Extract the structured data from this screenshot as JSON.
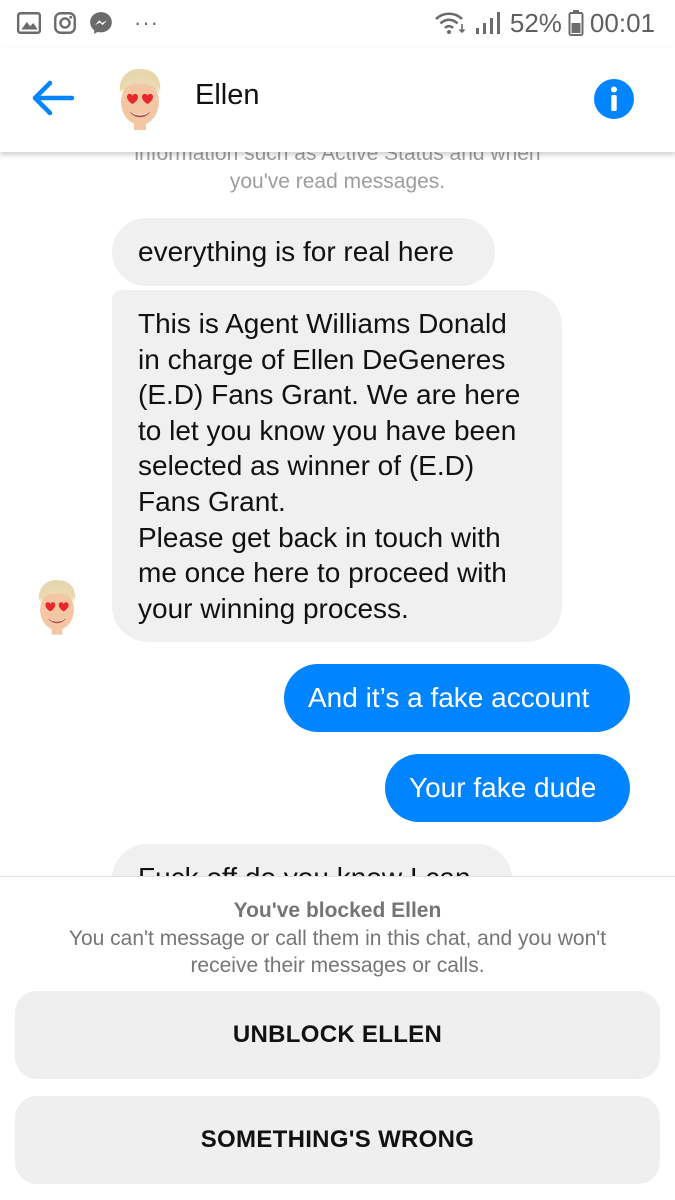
{
  "status_bar": {
    "icons_left": [
      "gallery-icon",
      "instagram-icon",
      "messenger-icon"
    ],
    "more": "···",
    "battery": "52%",
    "time": "00:01"
  },
  "header": {
    "contact_name": "Ellen",
    "back_icon": "back-arrow-icon",
    "info_icon": "info-icon"
  },
  "chat": {
    "privacy_note_line1": "information such as Active Status and when",
    "privacy_note_line2": "you've read messages.",
    "messages": [
      {
        "sender": "contact",
        "lines": [
          "everything is for real here"
        ]
      },
      {
        "sender": "contact",
        "lines": [
          "This is Agent Williams Donald",
          "in charge of Ellen DeGeneres",
          "(E.D) Fans Grant. We are here",
          "to let you know you have been",
          "selected as winner of (E.D)",
          "Fans Grant.",
          "Please get back in touch with",
          "me once here to proceed with",
          "your winning process."
        ]
      },
      {
        "sender": "me",
        "lines": [
          "And it’s a fake account"
        ]
      },
      {
        "sender": "me",
        "lines": [
          "Your fake dude"
        ]
      },
      {
        "sender": "contact",
        "lines": [
          "Fuck off do you know I can"
        ]
      }
    ]
  },
  "blocked_panel": {
    "title": "You've blocked Ellen",
    "description": "You can't message or call them in this chat, and you won't receive their messages or calls.",
    "unblock_label": "UNBLOCK ELLEN",
    "report_label": "SOMETHING'S WRONG"
  },
  "colors": {
    "accent": "#0084ff",
    "incoming_bubble": "#f0f0f0",
    "muted_text": "#757575"
  }
}
